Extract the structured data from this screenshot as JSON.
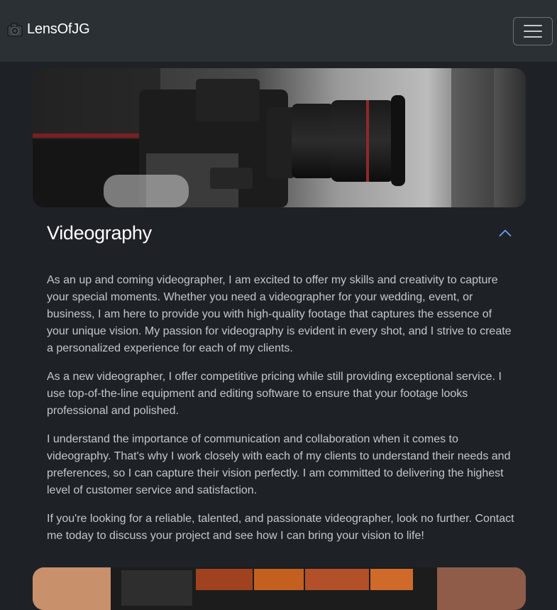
{
  "navbar": {
    "brand": "LensOfJG",
    "brand_icon": "camera-icon",
    "toggle_icon": "hamburger-menu-icon"
  },
  "section": {
    "title": "Videography",
    "expanded": true,
    "toggle_icon": "chevron-up-icon",
    "header_image": "videography-camera-photo",
    "paragraphs": [
      "As an up and coming videographer, I am excited to offer my skills and creativity to capture your special moments. Whether you need a videographer for your wedding, event, or business, I am here to provide you with high-quality footage that captures the essence of your unique vision. My passion for videography is evident in every shot, and I strive to create a personalized experience for each of my clients.",
      "As a new videographer, I offer competitive pricing while still providing exceptional service. I use top-of-the-line equipment and editing software to ensure that your footage looks professional and polished.",
      "I understand the importance of communication and collaboration when it comes to videography. That's why I work closely with each of my clients to understand their needs and preferences, so I can capture their vision perfectly. I am committed to delivering the highest level of customer service and satisfaction.",
      "If you're looking for a reliable, talented, and passionate videographer, look no further. Contact me today to discuss your project and see how I can bring your vision to life!"
    ]
  },
  "next_section": {
    "header_image": "video-editing-screen-photo"
  },
  "colors": {
    "page_background": "#1e2227",
    "navbar_background": "#2b3035",
    "accent": "#6ea8fe"
  }
}
